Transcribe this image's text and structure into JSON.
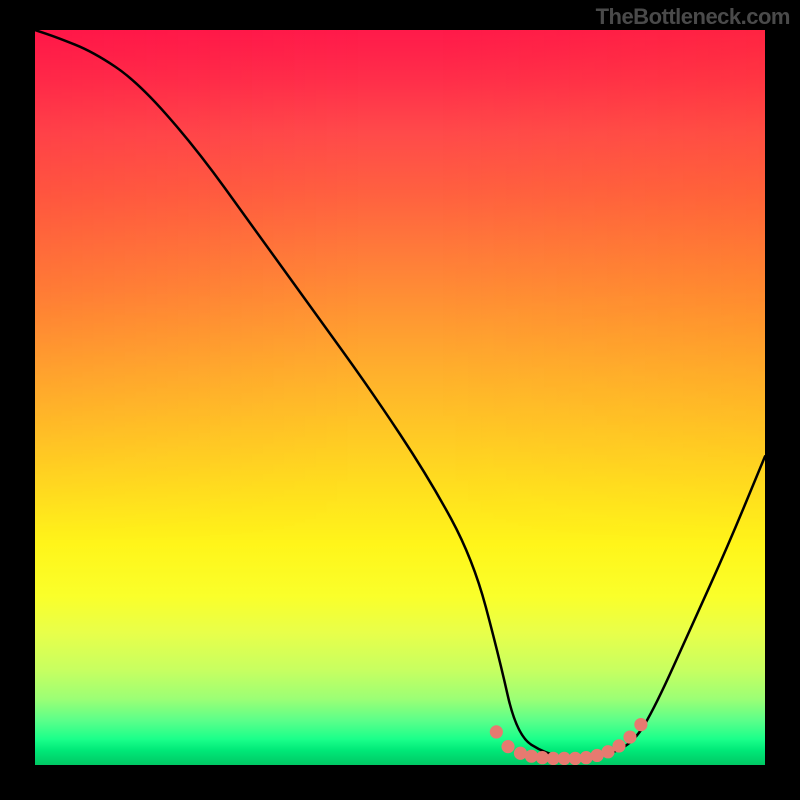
{
  "attribution": "TheBottleneck.com",
  "chart_data": {
    "type": "line",
    "title": "",
    "xlabel": "",
    "ylabel": "",
    "xlim": [
      0,
      100
    ],
    "ylim": [
      0,
      100
    ],
    "series": [
      {
        "name": "bottleneck-curve",
        "x": [
          0,
          3,
          8,
          14,
          22,
          30,
          38,
          46,
          54,
          60,
          63.5,
          66,
          70,
          74,
          78,
          82,
          85,
          90,
          95,
          100
        ],
        "y": [
          100,
          99,
          97,
          93,
          84,
          73,
          62,
          51,
          39,
          28,
          15,
          4,
          1.5,
          0.8,
          1.2,
          3,
          8,
          19,
          30,
          42
        ]
      }
    ],
    "markers": {
      "name": "highlight-dots",
      "color": "#e77a70",
      "points": [
        {
          "x": 63.2,
          "y": 4.5
        },
        {
          "x": 64.8,
          "y": 2.5
        },
        {
          "x": 66.5,
          "y": 1.6
        },
        {
          "x": 68.0,
          "y": 1.2
        },
        {
          "x": 69.5,
          "y": 1.0
        },
        {
          "x": 71.0,
          "y": 0.9
        },
        {
          "x": 72.5,
          "y": 0.9
        },
        {
          "x": 74.0,
          "y": 0.9
        },
        {
          "x": 75.5,
          "y": 1.0
        },
        {
          "x": 77.0,
          "y": 1.3
        },
        {
          "x": 78.5,
          "y": 1.8
        },
        {
          "x": 80.0,
          "y": 2.6
        },
        {
          "x": 81.5,
          "y": 3.8
        },
        {
          "x": 83.0,
          "y": 5.5
        }
      ]
    },
    "gradient_stops_vertical": [
      {
        "pos": 0.0,
        "color": "#ff1a4a"
      },
      {
        "pos": 0.5,
        "color": "#ffc626"
      },
      {
        "pos": 0.8,
        "color": "#f5ff3a"
      },
      {
        "pos": 0.96,
        "color": "#1aff8a"
      },
      {
        "pos": 1.0,
        "color": "#00c864"
      }
    ]
  }
}
